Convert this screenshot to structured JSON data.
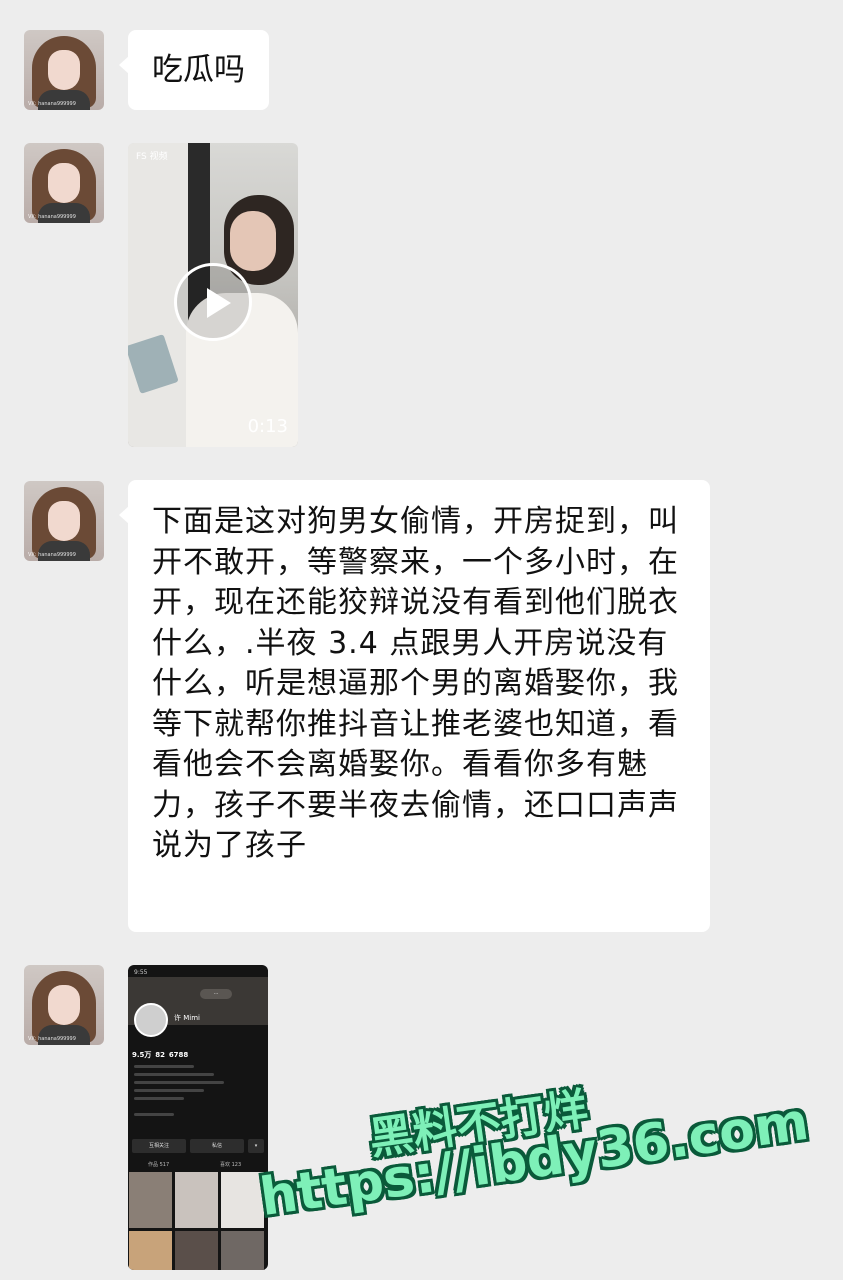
{
  "chat": {
    "avatar_watermark": "VX: hanana999999",
    "messages": [
      {
        "type": "text",
        "text": "吃瓜吗"
      },
      {
        "type": "video",
        "duration": "0:13",
        "source_mark": "FS 视频"
      },
      {
        "type": "text",
        "text": "下面是这对狗男女偷情，开房捉到，叫开不敢开，等警察来，一个多小时，在开，现在还能狡辩说没有看到他们脱衣什么，.半夜 3.4 点跟男人开房说没有什么，听是想逼那个男的离婚娶你，我等下就帮你推抖音让推老婆也知道，看看他会不会离婚娶你。看看你多有魅力，孩子不要半夜去偷情，还口口声声说为了孩子"
      },
      {
        "type": "image",
        "profile": {
          "status_time": "9:55",
          "name": "许 Mimi",
          "likes": "9.5万",
          "following": "82",
          "fans": "6788",
          "follow_button": "互相关注",
          "message_button": "私信",
          "works_tab": "作品 517",
          "likes_tab": "喜欢 123"
        }
      }
    ]
  },
  "watermark": {
    "line1": "黑料不打烊",
    "line2": "https://ibdy36.com"
  }
}
